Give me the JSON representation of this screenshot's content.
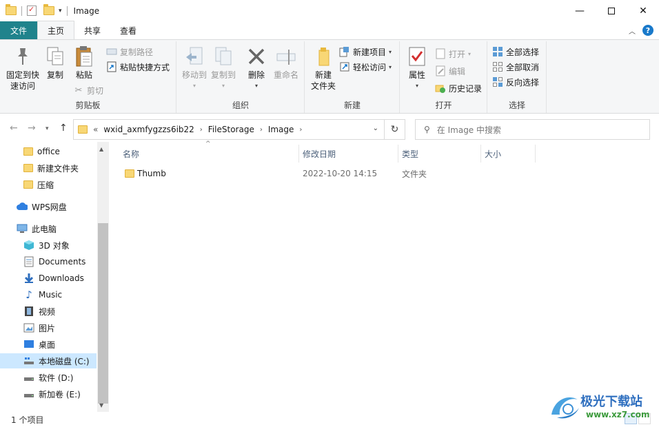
{
  "window": {
    "title": "Image"
  },
  "tabs": [
    {
      "label": "文件"
    },
    {
      "label": "主页"
    },
    {
      "label": "共享"
    },
    {
      "label": "查看"
    }
  ],
  "ribbon": {
    "clipboard": {
      "pin_line1": "固定到快",
      "pin_line2": "速访问",
      "copy": "复制",
      "paste": "粘贴",
      "copy_path": "复制路径",
      "paste_shortcut": "粘贴快捷方式",
      "cut": "剪切",
      "label": "剪贴板"
    },
    "organize": {
      "move_to": "移动到",
      "copy_to": "复制到",
      "delete": "删除",
      "rename": "重命名",
      "label": "组织"
    },
    "new": {
      "new_folder_line1": "新建",
      "new_folder_line2": "文件夹",
      "new_item": "新建项目",
      "easy_access": "轻松访问",
      "label": "新建"
    },
    "open": {
      "properties": "属性",
      "open": "打开",
      "edit": "编辑",
      "history": "历史记录",
      "label": "打开"
    },
    "select": {
      "select_all": "全部选择",
      "select_none": "全部取消",
      "invert": "反向选择",
      "label": "选择"
    }
  },
  "address": {
    "overflow": "«",
    "crumbs": [
      "wxid_axmfygzzs6ib22",
      "FileStorage",
      "Image"
    ]
  },
  "search": {
    "placeholder": "在 Image 中搜索"
  },
  "sidebar": {
    "items": [
      {
        "label": "office",
        "icon": "folder-icon"
      },
      {
        "label": "新建文件夹",
        "icon": "folder-icon"
      },
      {
        "label": "压缩",
        "icon": "folder-icon"
      },
      {
        "label": "WPS网盘",
        "icon": "cloud-icon"
      },
      {
        "label": "此电脑",
        "icon": "computer-icon"
      },
      {
        "label": "3D 对象",
        "icon": "cube-icon"
      },
      {
        "label": "Documents",
        "icon": "document-icon"
      },
      {
        "label": "Downloads",
        "icon": "download-icon"
      },
      {
        "label": "Music",
        "icon": "music-icon"
      },
      {
        "label": "视频",
        "icon": "video-icon"
      },
      {
        "label": "图片",
        "icon": "picture-icon"
      },
      {
        "label": "桌面",
        "icon": "desktop-icon"
      },
      {
        "label": "本地磁盘 (C:)",
        "icon": "drive-icon"
      },
      {
        "label": "软件 (D:)",
        "icon": "drive-icon"
      },
      {
        "label": "新加卷 (E:)",
        "icon": "drive-icon"
      }
    ]
  },
  "columns": {
    "name": "名称",
    "modified": "修改日期",
    "type": "类型",
    "size": "大小"
  },
  "files": [
    {
      "name": "Thumb",
      "modified": "2022-10-20 14:15",
      "type": "文件夹",
      "size": ""
    }
  ],
  "status": {
    "count": "1 个项目"
  },
  "watermark": {
    "text": "极光下载站",
    "url": "www.xz7.com"
  },
  "colors": {
    "file_tab": "#20838c",
    "selection": "#cce8ff",
    "accent": "#1979ca"
  }
}
